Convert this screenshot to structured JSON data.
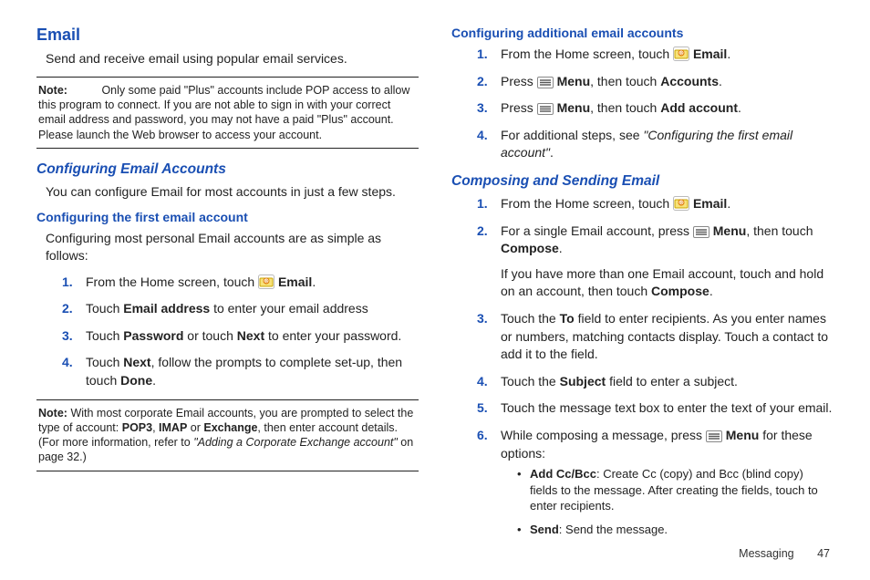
{
  "footer": {
    "section": "Messaging",
    "page": "47"
  },
  "left": {
    "title": "Email",
    "intro": "Send and receive email using popular email services.",
    "note1_label": "Note:",
    "note1_body": "Only some paid \"Plus\" accounts include POP access to allow this program to connect. If you are not able to sign in with your correct email address and password, you may not have a paid \"Plus\" account. Please launch the Web browser to access your account.",
    "sub1": "Configuring Email Accounts",
    "p1": "You can configure Email for most accounts in just a few steps.",
    "mini1": "Configuring the first email account",
    "p2": "Configuring most personal Email accounts are as simple as follows:",
    "s1a": "From the Home screen, touch ",
    "s1b": "Email",
    "s1c": ".",
    "s2a": "Touch ",
    "s2b": "Email address",
    "s2c": " to enter your email address",
    "s3a": "Touch ",
    "s3b": "Password",
    "s3c": " or touch ",
    "s3d": "Next",
    "s3e": " to enter your password.",
    "s4a": "Touch ",
    "s4b": "Next",
    "s4c": ", follow the prompts to complete set-up, then touch ",
    "s4d": "Done",
    "s4e": ".",
    "note2_label": "Note:",
    "note2_a": "With most corporate Email accounts, you are prompted to select the type of account: ",
    "note2_b": "POP3",
    "note2_c": ", ",
    "note2_d": "IMAP",
    "note2_e": " or ",
    "note2_f": "Exchange",
    "note2_g": ", then enter account details. (For more information, refer to ",
    "note2_h": "\"Adding a Corporate Exchange account\"",
    "note2_i": " on page 32.)"
  },
  "right": {
    "mini1": "Configuring additional email accounts",
    "a1a": "From the Home screen, touch ",
    "a1b": "Email",
    "a1c": ".",
    "a2a": "Press ",
    "a2b": "Menu",
    "a2c": ", then touch ",
    "a2d": "Accounts",
    "a2e": ".",
    "a3a": "Press ",
    "a3b": "Menu",
    "a3c": ", then touch ",
    "a3d": "Add account",
    "a3e": ".",
    "a4a": "For additional steps, see ",
    "a4b": "\"Configuring the first email account\"",
    "a4c": ".",
    "sub2": "Composing and Sending Email",
    "b1a": "From the Home screen, touch ",
    "b1b": "Email",
    "b1c": ".",
    "b2a": "For a single Email account, press ",
    "b2b": "Menu",
    "b2c": ", then touch ",
    "b2d": "Compose",
    "b2e": ".",
    "b2f": "If you have more than one Email account, touch and hold on an account, then touch ",
    "b2g": "Compose",
    "b2h": ".",
    "b3a": "Touch the ",
    "b3b": "To",
    "b3c": " field to enter recipients. As you enter names or numbers, matching contacts display. Touch a contact to add it to the field.",
    "b4a": "Touch the ",
    "b4b": "Subject",
    "b4c": " field to enter a subject.",
    "b5": "Touch the message text box to enter the text of your email.",
    "b6a": "While composing a message, press ",
    "b6b": "Menu",
    "b6c": " for these options:",
    "opt1a": "Add Cc/Bcc",
    "opt1b": ": Create Cc (copy) and Bcc (blind copy) fields to the message. After creating the fields, touch to enter recipients.",
    "opt2a": "Send",
    "opt2b": ": Send the message."
  }
}
